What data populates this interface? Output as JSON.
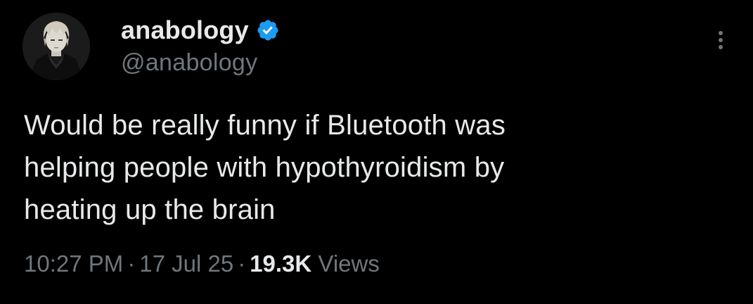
{
  "user": {
    "display_name": "anabology",
    "handle": "@anabology",
    "verified": true,
    "verified_color": "#1d9bf0",
    "avatar_icon": "anime-character-avatar"
  },
  "menu": {
    "icon": "more-options-icon"
  },
  "tweet": {
    "text": "Would be really funny if Bluetooth was\nhelping people with hypothyroidism by\nheating up the brain"
  },
  "meta": {
    "time": "10:27 PM",
    "date": "17 Jul 25",
    "separator": "·",
    "views_count": "19.3K",
    "views_label": "Views"
  },
  "colors": {
    "background": "#000000",
    "primary_text": "#e7e9ea",
    "secondary_text": "#71767b"
  }
}
